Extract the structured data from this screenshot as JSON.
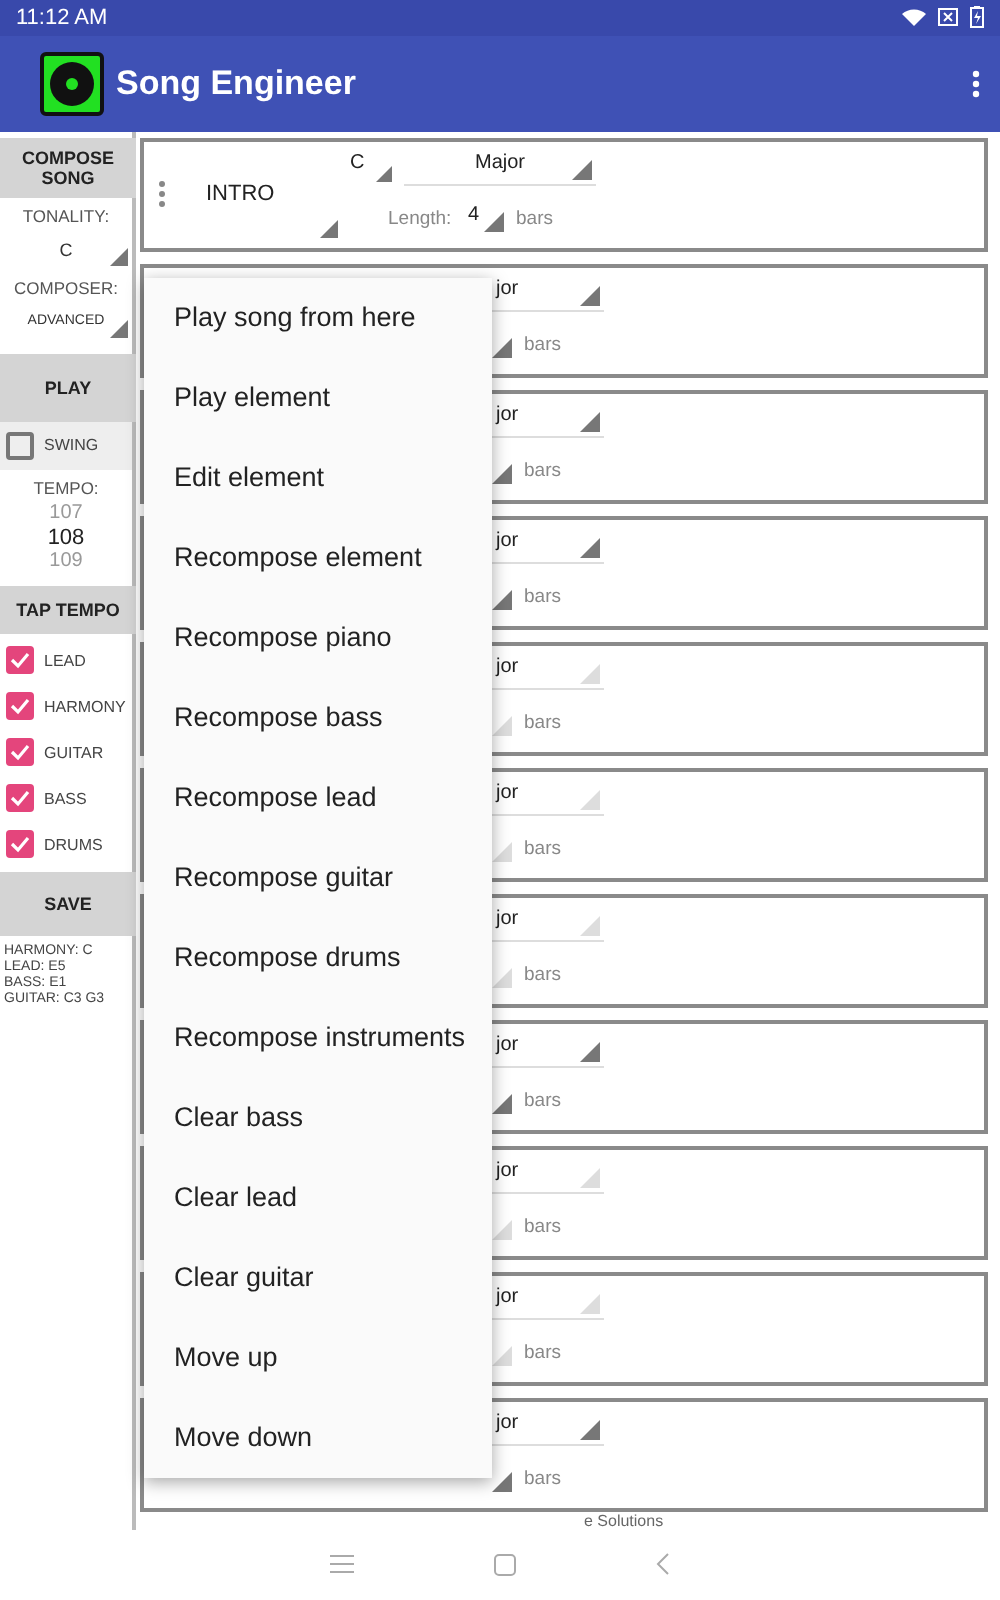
{
  "status_bar": {
    "time": "11:12 AM"
  },
  "app_bar": {
    "title": "Song Engineer"
  },
  "sidebar": {
    "compose_button": "COMPOSE SONG",
    "tonality_label": "TONALITY:",
    "tonality_value": "C",
    "composer_label": "COMPOSER:",
    "composer_value": "ADVANCED",
    "play_button": "PLAY",
    "swing": {
      "label": "SWING",
      "checked": false
    },
    "tempo_label": "TEMPO:",
    "tempo_picker": [
      {
        "value": "107",
        "selected": false
      },
      {
        "value": "108",
        "selected": true
      },
      {
        "value": "109",
        "selected": false
      }
    ],
    "tap_tempo_button": "TAP TEMPO",
    "instruments": [
      {
        "label": "LEAD",
        "checked": true
      },
      {
        "label": "HARMONY",
        "checked": true
      },
      {
        "label": "GUITAR",
        "checked": true
      },
      {
        "label": "BASS",
        "checked": true
      },
      {
        "label": "DRUMS",
        "checked": true
      }
    ],
    "save_button": "SAVE",
    "info_lines": [
      "HARMONY: C",
      "LEAD: E5",
      "BASS: E1",
      "GUITAR: C3  G3"
    ]
  },
  "elements": [
    {
      "name": "INTRO",
      "key": "C",
      "mode": "Major",
      "length_label": "Length:",
      "length": "4",
      "unit": "bars",
      "dimmed": false
    },
    {
      "mode": "jor",
      "unit": "bars",
      "dimmed": false
    },
    {
      "mode": "jor",
      "unit": "bars",
      "dimmed": false
    },
    {
      "mode": "jor",
      "unit": "bars",
      "dimmed": false
    },
    {
      "mode": "jor",
      "unit": "bars",
      "dimmed": true
    },
    {
      "mode": "jor",
      "unit": "bars",
      "dimmed": true
    },
    {
      "mode": "jor",
      "unit": "bars",
      "dimmed": true
    },
    {
      "mode": "jor",
      "unit": "bars",
      "dimmed": false
    },
    {
      "mode": "jor",
      "unit": "bars",
      "dimmed": true
    },
    {
      "mode": "jor",
      "unit": "bars",
      "dimmed": true
    },
    {
      "mode": "jor",
      "unit": "bars",
      "dimmed": false
    }
  ],
  "footer": "e Solutions",
  "context_menu": [
    "Play song from here",
    "Play element",
    "Edit element",
    "Recompose element",
    "Recompose piano",
    "Recompose bass",
    "Recompose lead",
    "Recompose guitar",
    "Recompose drums",
    "Recompose instruments",
    "Clear bass",
    "Clear lead",
    "Clear guitar",
    "Move up",
    "Move down"
  ]
}
